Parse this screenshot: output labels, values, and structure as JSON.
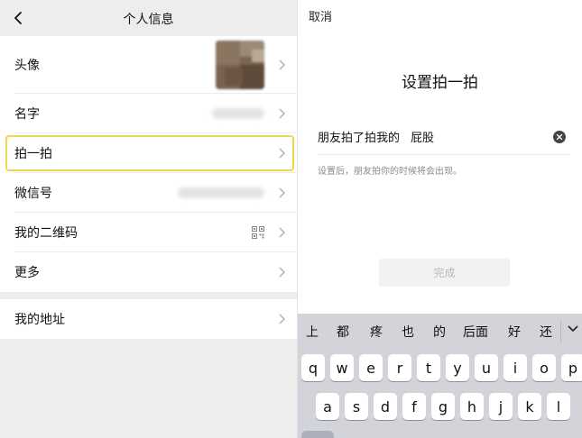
{
  "left": {
    "nav_title": "个人信息",
    "rows": {
      "avatar": "头像",
      "name": "名字",
      "pat": "拍一拍",
      "wechat_id": "微信号",
      "qrcode": "我的二维码",
      "more": "更多",
      "address": "我的地址"
    }
  },
  "right": {
    "cancel": "取消",
    "title": "设置拍一拍",
    "field_prefix": "朋友拍了拍我的",
    "field_value": "屁股",
    "hint": "设置后，朋友拍你的时候将会出现。",
    "done": "完成"
  },
  "keyboard": {
    "candidates": [
      "上",
      "都",
      "疼",
      "也",
      "的",
      "后面",
      "好",
      "还"
    ],
    "row1": [
      "q",
      "w",
      "e",
      "r",
      "t",
      "y",
      "u",
      "i",
      "o",
      "p"
    ],
    "row2": [
      "a",
      "s",
      "d",
      "f",
      "g",
      "h",
      "j",
      "k",
      "l"
    ]
  },
  "colors": {
    "highlight": "#f2d64b",
    "background": "#ededed",
    "keyboard": "#d2d4d9"
  }
}
